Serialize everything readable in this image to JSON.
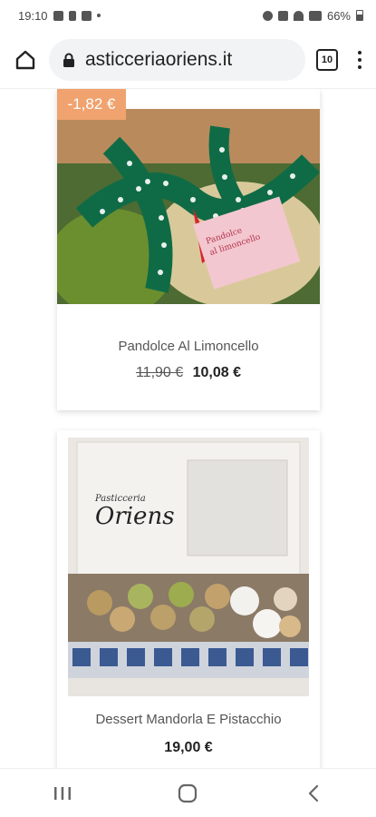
{
  "status_bar": {
    "time": "19:10",
    "battery": "66%"
  },
  "browser": {
    "url": "asticceriaoriens.it",
    "tab_count": "10"
  },
  "products": [
    {
      "discount_badge": "-1,82 €",
      "name": "Pandolce Al Limoncello",
      "old_price": "11,90 €",
      "price": "10,08 €",
      "image_text": [
        "Pandolce",
        "al limoncello"
      ]
    },
    {
      "name": "Dessert Mandorla E Pistacchio",
      "price": "19,00 €",
      "image_text": {
        "brand": "Oriens",
        "brand_top": "Pasticceria"
      }
    }
  ],
  "icons": [
    "home-icon",
    "lock-icon",
    "tabs-icon",
    "more-vert-icon",
    "recents-icon",
    "home-circle-icon",
    "back-icon"
  ]
}
